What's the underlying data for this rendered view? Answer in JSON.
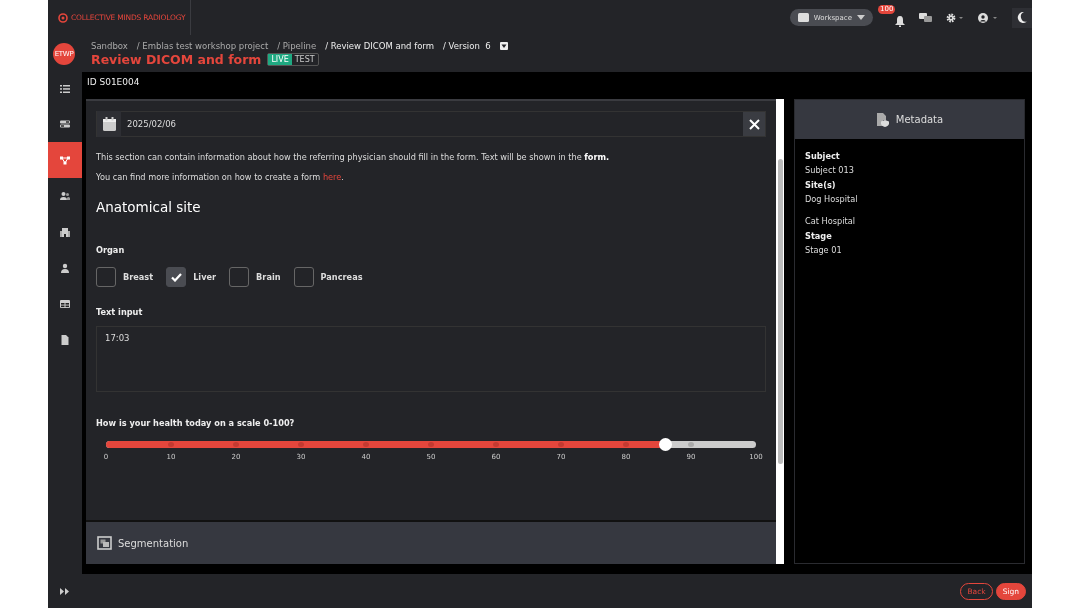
{
  "brand": "COLLECTIVE MINDS RADIOLOGY",
  "topbar": {
    "workspace": "Workspace",
    "notification_count": "100"
  },
  "project_badge": "ETWP",
  "breadcrumb": [
    "Sandbox",
    "/ Emblas test workshop project",
    "/ Pipeline",
    "/ Review DICOM and form",
    "/ Version  6"
  ],
  "page_title": "Review DICOM and form",
  "mode_toggle": [
    {
      "label": "LIVE",
      "selected": true
    },
    {
      "label": "TEST",
      "selected": false
    }
  ],
  "sidebar": [
    {
      "selected": false
    },
    {
      "selected": false
    },
    {
      "selected": true
    },
    {
      "selected": false
    },
    {
      "selected": false
    },
    {
      "selected": false
    },
    {
      "selected": false
    },
    {
      "selected": false
    }
  ],
  "record_id": "ID S01E004",
  "form": {
    "date": "2025/02/06",
    "intro": "This section can contain information about how the referring physician should fill in the form. Text will be shown in the **form.**",
    "more_info": "You can find more information on how to create a form ",
    "more_info_link": "here",
    "more_info_end": ".",
    "section_title": "Anatomical site",
    "organ_label": "Organ",
    "organs": [
      {
        "label": "Breast",
        "checked": false
      },
      {
        "label": "Liver",
        "checked": true
      },
      {
        "label": "Brain",
        "checked": false
      },
      {
        "label": "Pancreas",
        "checked": false
      }
    ],
    "text_input_label": "Text input",
    "text_input_value": "17:03",
    "slider_label": "How is your health today on a scale 0-100?",
    "slider": {
      "level": 0.86,
      "ticks": [
        "0",
        "10",
        "20",
        "30",
        "40",
        "50",
        "60",
        "70",
        "80",
        "90",
        "100"
      ]
    },
    "next_section": "Segmentation"
  },
  "metadata": {
    "title": "Metadata",
    "fields": [
      {
        "label": "Subject",
        "values": [
          "Subject 013"
        ]
      },
      {
        "label": "Site(s)",
        "values": [
          "Dog Hospital",
          "Cat Hospital"
        ]
      },
      {
        "label": "Stage",
        "values": [
          "Stage 01"
        ]
      }
    ]
  },
  "footer": {
    "buttons": [
      "Back",
      "Sign"
    ]
  }
}
